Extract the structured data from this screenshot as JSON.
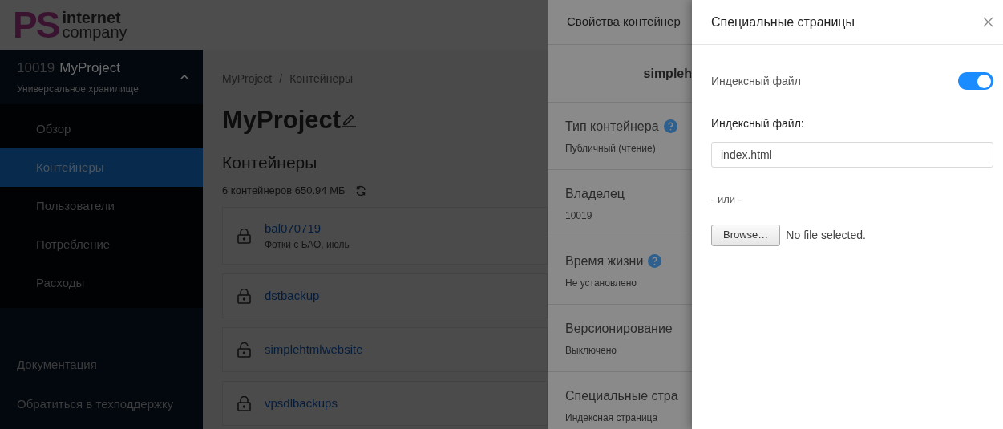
{
  "logo": {
    "mark": "PS",
    "line_1": "internet",
    "line_2": "company"
  },
  "sidebar": {
    "project_id": "10019",
    "project_name": "MyProject",
    "project_type": "Универсальное хранилище",
    "expanded": true,
    "items": [
      {
        "label": "Обзор",
        "selected": false
      },
      {
        "label": "Контейнеры",
        "selected": true
      },
      {
        "label": "Пользователи",
        "selected": false
      },
      {
        "label": "Потребление",
        "selected": false
      },
      {
        "label": "Расходы",
        "selected": false
      }
    ],
    "footer_links": [
      "Документация",
      "Обратиться в техподдержку"
    ]
  },
  "breadcrumb": {
    "items": [
      "MyProject",
      "Контейнеры"
    ],
    "separator": "/"
  },
  "page_title": "MyProject",
  "section_title": "Контейнеры",
  "summary": "6 контейнеров 650.94 МБ",
  "containers": [
    {
      "name": "bal070719",
      "description": "Фотки с БАО, июль",
      "locked": true
    },
    {
      "name": "dstbackup",
      "locked": true
    },
    {
      "name": "simplehtmlwebsite",
      "locked": false
    },
    {
      "name": "vpsdlbackups",
      "locked": true
    }
  ],
  "properties_panel": {
    "title": "Свойства контейнер",
    "container_name": "simpleh",
    "properties": [
      {
        "label": "Тип контейнера",
        "help": true,
        "value": "Публичный (чтение)"
      },
      {
        "label": "Владелец",
        "help": false,
        "value": "10019"
      },
      {
        "label": "Время жизни",
        "help": true,
        "value": "Не установлено"
      },
      {
        "label": "Версионирование",
        "help": false,
        "value": "Выключено"
      },
      {
        "label": "Специальные стра",
        "help": false,
        "value": "Индексная страница"
      }
    ]
  },
  "special_pages_panel": {
    "title": "Специальные страницы",
    "toggle_label": "Индексный файл",
    "toggle_on": true,
    "field_label": "Индексный файл:",
    "field_value": "index.html",
    "separator": "- или -",
    "browse_button": "Browse…",
    "file_status": "No file selected."
  }
}
